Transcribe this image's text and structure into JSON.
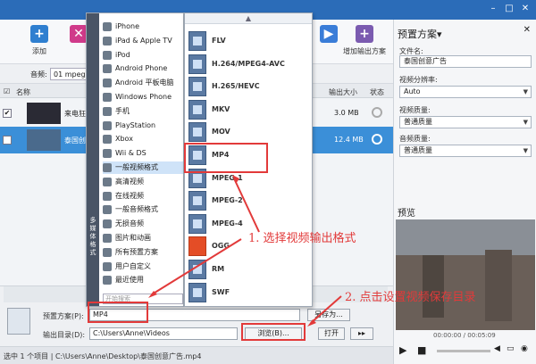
{
  "toolbar": {
    "add_label": "添加",
    "add_output_label": "增加输出方案"
  },
  "subbar": {
    "audio_label": "音频:",
    "audio_value": "01 mpeg4"
  },
  "list": {
    "col_name": "名称",
    "col_output_size": "输出大小",
    "col_status": "状态",
    "rows": [
      {
        "checked": "✔",
        "name": "来电狂想",
        "size": "3.0 MB"
      },
      {
        "checked": "✔",
        "name": "泰国创",
        "size": "12.4 MB"
      }
    ]
  },
  "categories": {
    "vertical_label": "多媒体格式",
    "items": [
      "iPhone",
      "iPad & Apple TV",
      "iPod",
      "Android Phone",
      "Android 平板电脑",
      "Windows Phone",
      "手机",
      "PlayStation",
      "Xbox",
      "Wii & DS",
      "一般视频格式",
      "高清视频",
      "在线视频",
      "一般音频格式",
      "无损音频",
      "图片和动画",
      "所有预置方案",
      "用户自定义",
      "最近使用"
    ],
    "selected": "一般视频格式",
    "search_placeholder": "开始搜索"
  },
  "formats": {
    "items": [
      "FLV",
      "H.264/MPEG4-AVC",
      "H.265/HEVC",
      "MKV",
      "MOV",
      "MP4",
      "MPEG-1",
      "MPEG-2",
      "MPEG-4",
      "OGG",
      "RM",
      "SWF"
    ],
    "selected": "MP4"
  },
  "annotations": {
    "step1": "1. 选择视频输出格式",
    "step2": "2. 点击设置视频保存目录"
  },
  "right_panel": {
    "title": "预置方案▾",
    "filename_label": "文件名:",
    "filename_value": "泰国创意广告",
    "resolution_label": "视频分辨率:",
    "resolution_value": "Auto",
    "video_quality_label": "视频质量:",
    "video_quality_value": "普通质量",
    "audio_quality_label": "音频质量:",
    "audio_quality_value": "普通质量",
    "preview_title": "预览",
    "time": "00:00:00 / 00:05:09"
  },
  "bottom": {
    "preset_label": "预置方案(P):",
    "preset_value": "MP4",
    "save_as_label": "另存为...",
    "output_label": "输出目录(D):",
    "output_value": "C:\\Users\\Anne\\Videos",
    "browse_label": "浏览(B)...",
    "open_label": "打开"
  },
  "status": {
    "text": "选中 1 个项目 | C:\\Users\\Anne\\Desktop\\泰国创意广告.mp4"
  },
  "colors": {
    "titlebar": "#2b6cb8",
    "annotation": "#e23a3a",
    "selection": "#cfe3f8"
  }
}
